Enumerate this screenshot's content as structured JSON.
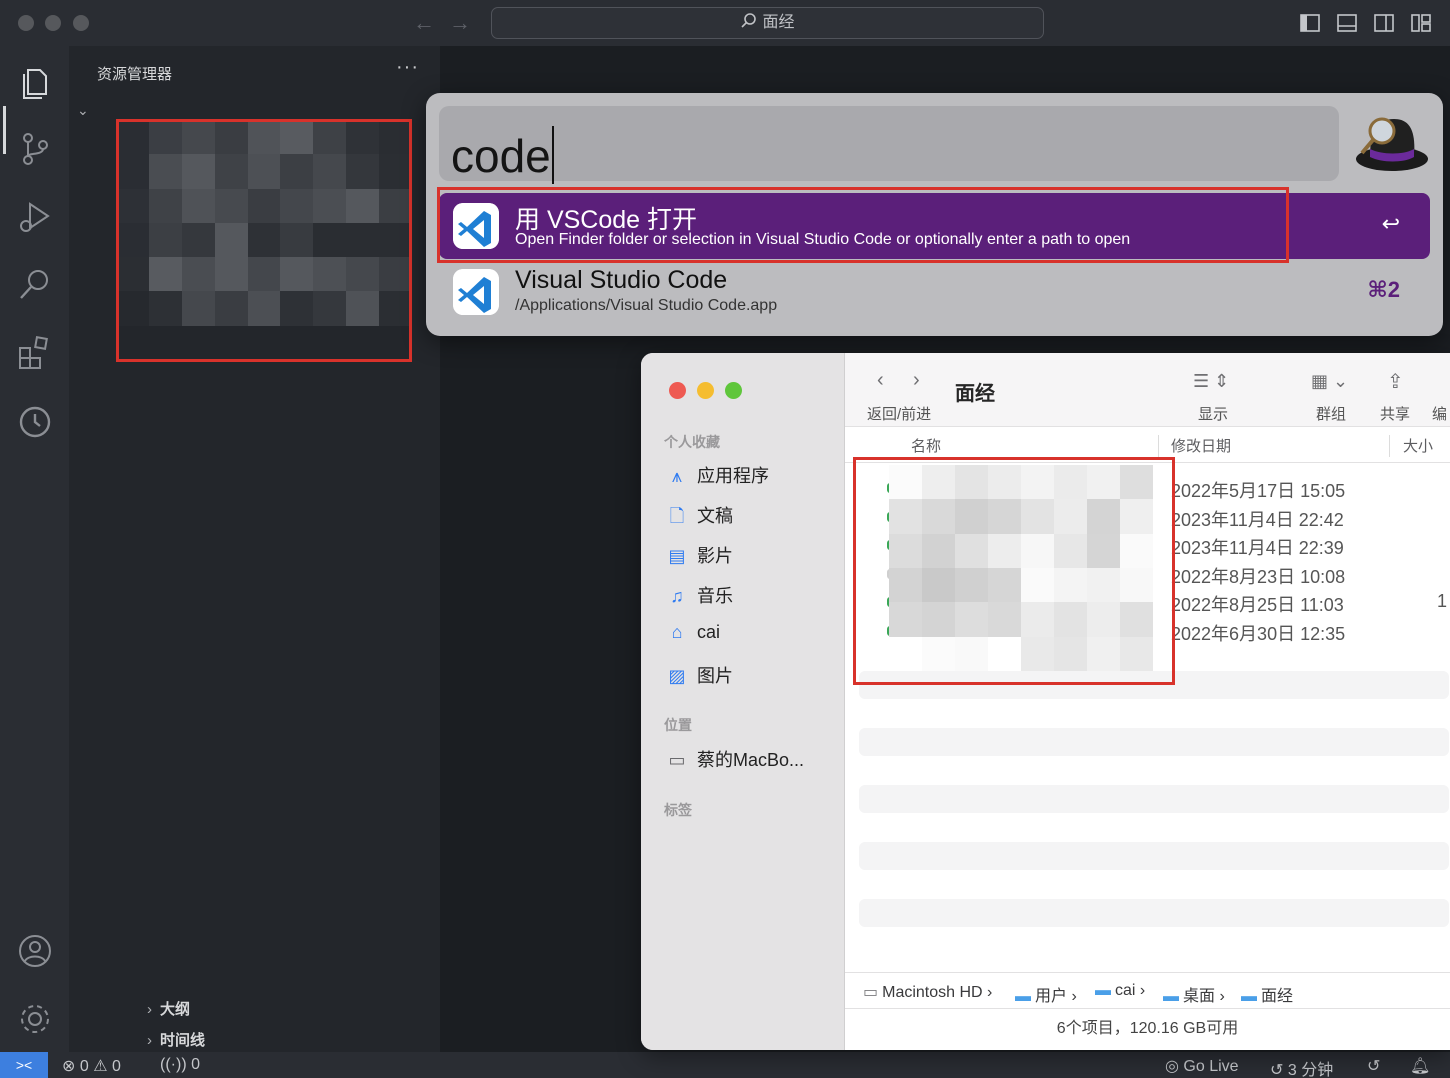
{
  "vscode": {
    "search_center": "面经",
    "explorer_title": "资源管理器",
    "explorer_more": "···",
    "outline_label": "大纲",
    "timeline_label": "时间线",
    "status": {
      "errors": "0",
      "warnings": "0",
      "ports": "0",
      "go_live": "Go Live",
      "time_ago": "3 分钟"
    }
  },
  "alfred": {
    "query": "code",
    "results": [
      {
        "title": "用 VSCode 打开",
        "subtitle": "Open Finder folder or selection in Visual Studio Code or optionally enter a path to open",
        "key": "↩",
        "icon": "vscode-icon"
      },
      {
        "title": "Visual Studio Code",
        "subtitle": "/Applications/Visual Studio Code.app",
        "key": "⌘2",
        "icon": "vscode-icon"
      }
    ]
  },
  "finder": {
    "title": "面经",
    "toolbar": {
      "back_forward": "返回/前进",
      "view": "显示",
      "group": "群组",
      "share": "共享",
      "edit": "编"
    },
    "sidebar": {
      "favorites_header": "个人收藏",
      "favorites": [
        {
          "label": "应用程序",
          "icon": "applications-icon"
        },
        {
          "label": "文稿",
          "icon": "document-icon"
        },
        {
          "label": "影片",
          "icon": "film-icon"
        },
        {
          "label": "音乐",
          "icon": "music-icon"
        },
        {
          "label": "cai",
          "icon": "home-icon"
        },
        {
          "label": "图片",
          "icon": "pictures-icon"
        }
      ],
      "locations_header": "位置",
      "locations": [
        {
          "label": "蔡的MacBo...",
          "icon": "laptop-icon"
        }
      ],
      "tags_header": "标签"
    },
    "columns": {
      "name": "名称",
      "modified": "修改日期",
      "size": "大小"
    },
    "rows": [
      {
        "date": "2022年5月17日 15:05",
        "size": ""
      },
      {
        "date": "2023年11月4日 22:42",
        "size": ""
      },
      {
        "date": "2023年11月4日 22:39",
        "size": ""
      },
      {
        "date": "2022年8月23日 10:08",
        "size": ""
      },
      {
        "date": "2022年8月25日 11:03",
        "size": "1"
      },
      {
        "date": "2022年6月30日 12:35",
        "size": ""
      }
    ],
    "path": [
      "Macintosh HD",
      "用户",
      "cai",
      "桌面",
      "面经"
    ],
    "status_text": "6个项目，120.16 GB可用"
  }
}
